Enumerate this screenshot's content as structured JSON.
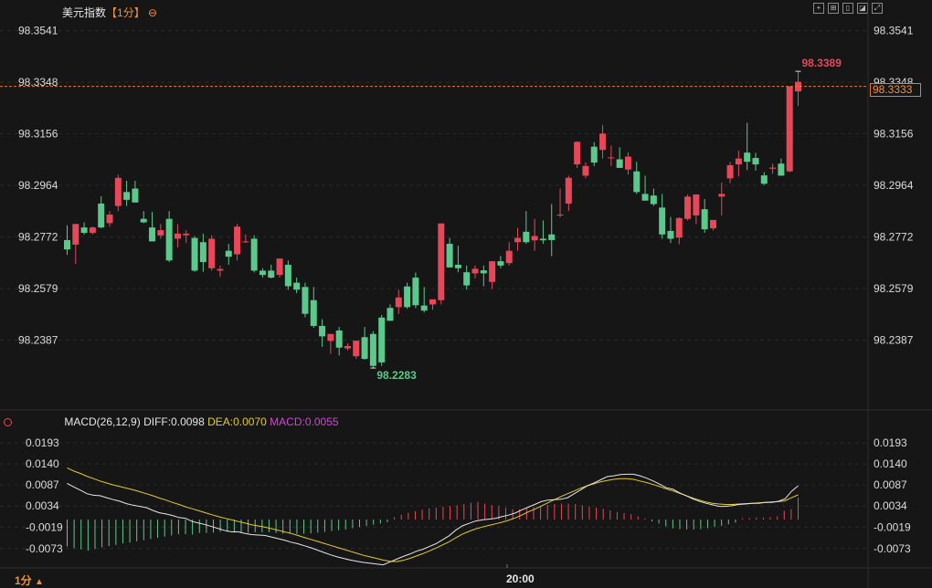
{
  "header": {
    "instrument": "美元指数",
    "period_tag": "【1分】",
    "settings_glyph": "⊖"
  },
  "toolbar": {
    "icons": [
      "crosshair-icon",
      "grid-icon",
      "chart-mode-icon",
      "indicator-icon",
      "fullscreen-icon"
    ]
  },
  "current_price_label": "98.3333",
  "high_label": "98.3389",
  "low_label": "98.2283",
  "macd_header": {
    "params": "MACD(26,12,9)",
    "diff": "DIFF:0.0098",
    "dea": "DEA:0.0070",
    "macd": "MACD:0.0055"
  },
  "footer": {
    "period": "1分",
    "arrow": "▲",
    "time_label": "20:00"
  },
  "colors": {
    "up": "#e8475a",
    "down": "#5cc98c",
    "diff_line": "#e6e6e6",
    "dea_line": "#e2cc2c",
    "macd_label": "#d345d6",
    "accent": "#f0913f"
  },
  "chart_data": [
    {
      "type": "candlestick",
      "title": "美元指数 1分",
      "y_ticks": [
        "98.3541",
        "98.3348",
        "98.3156",
        "98.2964",
        "98.2772",
        "98.2579",
        "98.2387"
      ],
      "ylim": [
        98.2256,
        98.358
      ],
      "current_price": 98.3333,
      "high": 98.3389,
      "low": 98.2283,
      "candles": [
        {
          "o": 98.276,
          "h": 98.2815,
          "l": 98.2705,
          "c": 98.2725
        },
        {
          "o": 98.2743,
          "h": 98.281,
          "l": 98.2671,
          "c": 98.282
        },
        {
          "o": 98.2807,
          "h": 98.2826,
          "l": 98.2781,
          "c": 98.2787
        },
        {
          "o": 98.2787,
          "h": 98.281,
          "l": 98.2781,
          "c": 98.2807
        },
        {
          "o": 98.2896,
          "h": 98.2923,
          "l": 98.2804,
          "c": 98.2807
        },
        {
          "o": 98.2823,
          "h": 98.2868,
          "l": 98.281,
          "c": 98.2855
        },
        {
          "o": 98.2887,
          "h": 98.3004,
          "l": 98.2868,
          "c": 98.2992
        },
        {
          "o": 98.2939,
          "h": 98.2981,
          "l": 98.2887,
          "c": 98.291
        },
        {
          "o": 98.2952,
          "h": 98.2981,
          "l": 98.2932,
          "c": 98.29
        },
        {
          "o": 98.2839,
          "h": 98.2868,
          "l": 98.2823,
          "c": 98.2826
        },
        {
          "o": 98.2807,
          "h": 98.2865,
          "l": 98.2787,
          "c": 98.2755
        },
        {
          "o": 98.2777,
          "h": 98.282,
          "l": 98.2765,
          "c": 98.2797
        },
        {
          "o": 98.2839,
          "h": 98.2868,
          "l": 98.2678,
          "c": 98.2684
        },
        {
          "o": 98.2765,
          "h": 98.282,
          "l": 98.2733,
          "c": 98.2784
        },
        {
          "o": 98.2778,
          "h": 98.2797,
          "l": 98.2749,
          "c": 98.2784
        },
        {
          "o": 98.2768,
          "h": 98.2775,
          "l": 98.2642,
          "c": 98.2646
        },
        {
          "o": 98.2752,
          "h": 98.2784,
          "l": 98.2642,
          "c": 98.2678
        },
        {
          "o": 98.2655,
          "h": 98.2778,
          "l": 98.2646,
          "c": 98.2765
        },
        {
          "o": 98.2646,
          "h": 98.2665,
          "l": 98.2623,
          "c": 98.2652
        },
        {
          "o": 98.272,
          "h": 98.2746,
          "l": 98.2668,
          "c": 98.2698
        },
        {
          "o": 98.2707,
          "h": 98.282,
          "l": 98.2684,
          "c": 98.281
        },
        {
          "o": 98.2755,
          "h": 98.2781,
          "l": 98.2749,
          "c": 98.2755
        },
        {
          "o": 98.2765,
          "h": 98.2778,
          "l": 98.2639,
          "c": 98.2646
        },
        {
          "o": 98.2646,
          "h": 98.2655,
          "l": 98.262,
          "c": 98.263
        },
        {
          "o": 98.2646,
          "h": 98.2668,
          "l": 98.2617,
          "c": 98.262
        },
        {
          "o": 98.263,
          "h": 98.2691,
          "l": 98.262,
          "c": 98.2691
        },
        {
          "o": 98.2668,
          "h": 98.2684,
          "l": 98.2575,
          "c": 98.2588
        },
        {
          "o": 98.2601,
          "h": 98.262,
          "l": 98.2562,
          "c": 98.2575
        },
        {
          "o": 98.2585,
          "h": 98.2601,
          "l": 98.2472,
          "c": 98.2485
        },
        {
          "o": 98.2536,
          "h": 98.2585,
          "l": 98.2433,
          "c": 98.244
        },
        {
          "o": 98.244,
          "h": 98.2465,
          "l": 98.2362,
          "c": 98.2401
        },
        {
          "o": 98.2384,
          "h": 98.241,
          "l": 98.2336,
          "c": 98.241
        },
        {
          "o": 98.2423,
          "h": 98.2436,
          "l": 98.233,
          "c": 98.2359
        },
        {
          "o": 98.2356,
          "h": 98.2375,
          "l": 98.2349,
          "c": 98.2365
        },
        {
          "o": 98.2327,
          "h": 98.2385,
          "l": 98.2317,
          "c": 98.2385
        },
        {
          "o": 98.2398,
          "h": 98.2436,
          "l": 98.2314,
          "c": 98.2317
        },
        {
          "o": 98.241,
          "h": 98.242,
          "l": 98.2283,
          "c": 98.2291
        },
        {
          "o": 98.2471,
          "h": 98.2481,
          "l": 98.2291,
          "c": 98.2304
        },
        {
          "o": 98.2507,
          "h": 98.252,
          "l": 98.2459,
          "c": 98.2459
        },
        {
          "o": 98.251,
          "h": 98.2575,
          "l": 98.2484,
          "c": 98.2546
        },
        {
          "o": 98.2587,
          "h": 98.2601,
          "l": 98.2504,
          "c": 98.251
        },
        {
          "o": 98.262,
          "h": 98.2639,
          "l": 98.2506,
          "c": 98.2517
        },
        {
          "o": 98.2516,
          "h": 98.2585,
          "l": 98.249,
          "c": 98.2497
        },
        {
          "o": 98.252,
          "h": 98.2528,
          "l": 98.25,
          "c": 98.2539
        },
        {
          "o": 98.2536,
          "h": 98.2822,
          "l": 98.252,
          "c": 98.2822
        },
        {
          "o": 98.2746,
          "h": 98.2768,
          "l": 98.2658,
          "c": 98.2658
        },
        {
          "o": 98.2668,
          "h": 98.2739,
          "l": 98.264,
          "c": 98.2655
        },
        {
          "o": 98.264,
          "h": 98.2665,
          "l": 98.2575,
          "c": 98.2591
        },
        {
          "o": 98.2636,
          "h": 98.2665,
          "l": 98.2617,
          "c": 98.2653
        },
        {
          "o": 98.2647,
          "h": 98.2665,
          "l": 98.2588,
          "c": 98.2636
        },
        {
          "o": 98.2604,
          "h": 98.2681,
          "l": 98.2578,
          "c": 98.2681
        },
        {
          "o": 98.2681,
          "h": 98.2701,
          "l": 98.2655,
          "c": 98.2665
        },
        {
          "o": 98.2674,
          "h": 98.2752,
          "l": 98.2665,
          "c": 98.272
        },
        {
          "o": 98.2752,
          "h": 98.2805,
          "l": 98.272,
          "c": 98.2768
        },
        {
          "o": 98.2791,
          "h": 98.2868,
          "l": 98.2746,
          "c": 98.2752
        },
        {
          "o": 98.2759,
          "h": 98.2839,
          "l": 98.272,
          "c": 98.2775
        },
        {
          "o": 98.2765,
          "h": 98.2833,
          "l": 98.2746,
          "c": 98.2759
        },
        {
          "o": 98.2781,
          "h": 98.2894,
          "l": 98.27,
          "c": 98.276
        },
        {
          "o": 98.2855,
          "h": 98.2952,
          "l": 98.2845,
          "c": 98.2855
        },
        {
          "o": 98.2896,
          "h": 98.3,
          "l": 98.2868,
          "c": 98.2992
        },
        {
          "o": 98.3042,
          "h": 98.3128,
          "l": 98.3029,
          "c": 98.3126
        },
        {
          "o": 98.3,
          "h": 98.305,
          "l": 98.299,
          "c": 98.3036
        },
        {
          "o": 98.3108,
          "h": 98.3125,
          "l": 98.3036,
          "c": 98.3049
        },
        {
          "o": 98.3096,
          "h": 98.3189,
          "l": 98.3064,
          "c": 98.3157
        },
        {
          "o": 98.3068,
          "h": 98.3112,
          "l": 98.3036,
          "c": 98.3068
        },
        {
          "o": 98.3061,
          "h": 98.3106,
          "l": 98.3029,
          "c": 98.3029
        },
        {
          "o": 98.3023,
          "h": 98.3087,
          "l": 98.3004,
          "c": 98.3071
        },
        {
          "o": 98.3016,
          "h": 98.3052,
          "l": 98.2932,
          "c": 98.2939
        },
        {
          "o": 98.2932,
          "h": 98.3,
          "l": 98.2913,
          "c": 98.2907
        },
        {
          "o": 98.2926,
          "h": 98.2952,
          "l": 98.2887,
          "c": 98.2894
        },
        {
          "o": 98.2881,
          "h": 98.2932,
          "l": 98.2765,
          "c": 98.2781
        },
        {
          "o": 98.2794,
          "h": 98.2846,
          "l": 98.2749,
          "c": 98.2765
        },
        {
          "o": 98.2769,
          "h": 98.2845,
          "l": 98.2744,
          "c": 98.2842
        },
        {
          "o": 98.2839,
          "h": 98.293,
          "l": 98.2833,
          "c": 98.2922
        },
        {
          "o": 98.2852,
          "h": 98.2922,
          "l": 98.282,
          "c": 98.293
        },
        {
          "o": 98.2875,
          "h": 98.2913,
          "l": 98.2787,
          "c": 98.28
        },
        {
          "o": 98.2804,
          "h": 98.2825,
          "l": 98.2796,
          "c": 98.2835
        },
        {
          "o": 98.2922,
          "h": 98.2974,
          "l": 98.2852,
          "c": 98.2932
        },
        {
          "o": 98.299,
          "h": 98.3051,
          "l": 98.2972,
          "c": 98.3039
        },
        {
          "o": 98.3042,
          "h": 98.3093,
          "l": 98.2997,
          "c": 98.3064
        },
        {
          "o": 98.3086,
          "h": 98.3197,
          "l": 98.3021,
          "c": 98.3052
        },
        {
          "o": 98.3066,
          "h": 98.3085,
          "l": 98.3019,
          "c": 98.3042
        },
        {
          "o": 98.3001,
          "h": 98.3013,
          "l": 98.2965,
          "c": 98.297
        },
        {
          "o": 98.3026,
          "h": 98.3045,
          "l": 98.3007,
          "c": 98.303
        },
        {
          "o": 98.3045,
          "h": 98.3064,
          "l": 98.3,
          "c": 98.3
        },
        {
          "o": 98.3016,
          "h": 98.3333,
          "l": 98.3013,
          "c": 98.3333
        },
        {
          "o": 98.3314,
          "h": 98.3389,
          "l": 98.326,
          "c": 98.335
        }
      ]
    },
    {
      "type": "line",
      "title": "MACD(26,12,9)",
      "y_ticks": [
        "0.0193",
        "0.0140",
        "0.0087",
        "0.0034",
        "-0.0019",
        "-0.0073"
      ],
      "ylim": [
        -0.0131,
        0.0216
      ],
      "series": [
        {
          "name": "DIFF",
          "values": [
            0.0091,
            0.0082,
            0.0074,
            0.0065,
            0.0061,
            0.006,
            0.0055,
            0.005,
            0.0046,
            0.004,
            0.0036,
            0.0033,
            0.003,
            0.0023,
            0.0017,
            0.0014,
            0.001,
            0.0005,
            0.0003,
            -0.0005,
            -0.0009,
            -0.0013,
            -0.0018,
            -0.0023,
            -0.0028,
            -0.0031,
            -0.0031,
            -0.0035,
            -0.0038,
            -0.0039,
            -0.004,
            -0.0044,
            -0.0048,
            -0.0052,
            -0.0057,
            -0.0061,
            -0.0066,
            -0.0071,
            -0.0077,
            -0.0083,
            -0.0089,
            -0.0094,
            -0.0098,
            -0.0102,
            -0.0105,
            -0.0108,
            -0.011,
            -0.0112,
            -0.0114,
            -0.0107,
            -0.01,
            -0.0093,
            -0.0087,
            -0.008,
            -0.0075,
            -0.0068,
            -0.0061,
            -0.0051,
            -0.0041,
            -0.0027,
            -0.0016,
            -0.001,
            -0.0004,
            -0.0001,
            0.0001,
            0.0003,
            0.0007,
            0.0011,
            0.0016,
            0.0024,
            0.0031,
            0.0038,
            0.0045,
            0.0049,
            0.005,
            0.0051,
            0.0055,
            0.0065,
            0.0075,
            0.0085,
            0.0092,
            0.01,
            0.0108,
            0.011,
            0.0113,
            0.0114,
            0.0114,
            0.011,
            0.0104,
            0.0097,
            0.0089,
            0.008,
            0.0076,
            0.0067,
            0.006,
            0.0052,
            0.0046,
            0.0041,
            0.0037,
            0.0033,
            0.0033,
            0.0035,
            0.0038,
            0.0039,
            0.0041,
            0.0041,
            0.0043,
            0.0043,
            0.0046,
            0.0052,
            0.0071,
            0.0085
          ]
        },
        {
          "name": "DEA",
          "values": [
            0.013,
            0.0122,
            0.0116,
            0.0109,
            0.0103,
            0.0097,
            0.0092,
            0.0087,
            0.0083,
            0.0079,
            0.0075,
            0.007,
            0.0065,
            0.006,
            0.0054,
            0.0049,
            0.0043,
            0.0038,
            0.0032,
            0.0027,
            0.0022,
            0.0017,
            0.0012,
            0.0007,
            0.0003,
            -0.0001,
            -0.0005,
            -0.0009,
            -0.0013,
            -0.0016,
            -0.0019,
            -0.0023,
            -0.0027,
            -0.0031,
            -0.0035,
            -0.004,
            -0.0045,
            -0.005,
            -0.0055,
            -0.006,
            -0.0065,
            -0.007,
            -0.0075,
            -0.008,
            -0.0085,
            -0.009,
            -0.0094,
            -0.0098,
            -0.0102,
            -0.0105,
            -0.0106,
            -0.0103,
            -0.0098,
            -0.0092,
            -0.0086,
            -0.0079,
            -0.0072,
            -0.0064,
            -0.0056,
            -0.0046,
            -0.0037,
            -0.003,
            -0.0024,
            -0.0019,
            -0.0015,
            -0.0011,
            -0.0007,
            -0.0002,
            0.0004,
            0.0011,
            0.0019,
            0.0026,
            0.0034,
            0.0042,
            0.005,
            0.0058,
            0.0065,
            0.0072,
            0.0079,
            0.0085,
            0.009,
            0.0095,
            0.0098,
            0.0101,
            0.0103,
            0.0103,
            0.0101,
            0.0097,
            0.0093,
            0.0088,
            0.0083,
            0.0077,
            0.0072,
            0.0066,
            0.006,
            0.0054,
            0.0049,
            0.0044,
            0.0041,
            0.0039,
            0.0038,
            0.0038,
            0.0039,
            0.004,
            0.0041,
            0.0042,
            0.0043,
            0.0044,
            0.0045,
            0.0047,
            0.0055,
            0.0062
          ]
        },
        {
          "name": "MACD",
          "values": [
            -0.0068,
            -0.0072,
            -0.0075,
            -0.0078,
            -0.0074,
            -0.007,
            -0.0067,
            -0.0064,
            -0.006,
            -0.0058,
            -0.0055,
            -0.0052,
            -0.0049,
            -0.0046,
            -0.0043,
            -0.004,
            -0.0037,
            -0.0037,
            -0.0038,
            -0.0034,
            -0.0034,
            -0.0033,
            -0.0031,
            -0.0031,
            -0.0033,
            -0.0034,
            -0.0033,
            -0.0032,
            -0.0032,
            -0.0032,
            -0.0034,
            -0.0036,
            -0.0036,
            -0.0036,
            -0.0036,
            -0.0035,
            -0.0033,
            -0.0031,
            -0.0029,
            -0.0027,
            -0.0025,
            -0.0022,
            -0.0019,
            -0.0016,
            -0.0013,
            -0.001,
            -0.0007,
            0.0006,
            0.0012,
            0.0017,
            0.0021,
            0.0025,
            0.0028,
            0.003,
            0.0032,
            0.0034,
            0.0036,
            0.0039,
            0.0042,
            0.0044,
            0.004,
            0.0036,
            0.0034,
            0.003,
            0.0026,
            0.0026,
            0.0028,
            0.0031,
            0.0034,
            0.0037,
            0.0039,
            0.004,
            0.004,
            0.0039,
            0.0036,
            0.0033,
            0.003,
            0.0027,
            0.0023,
            0.0019,
            0.0016,
            0.0013,
            0.0008,
            0.0003,
            -0.0005,
            -0.001,
            -0.0017,
            -0.0022,
            -0.0024,
            -0.0025,
            -0.0025,
            -0.0024,
            -0.0022,
            -0.0019,
            -0.0016,
            -0.0012,
            -0.0008,
            0.0003,
            0.0004,
            0.0005,
            0.0005,
            0.0006,
            0.0008,
            0.0022,
            0.0026,
            0.0055
          ]
        }
      ]
    }
  ]
}
